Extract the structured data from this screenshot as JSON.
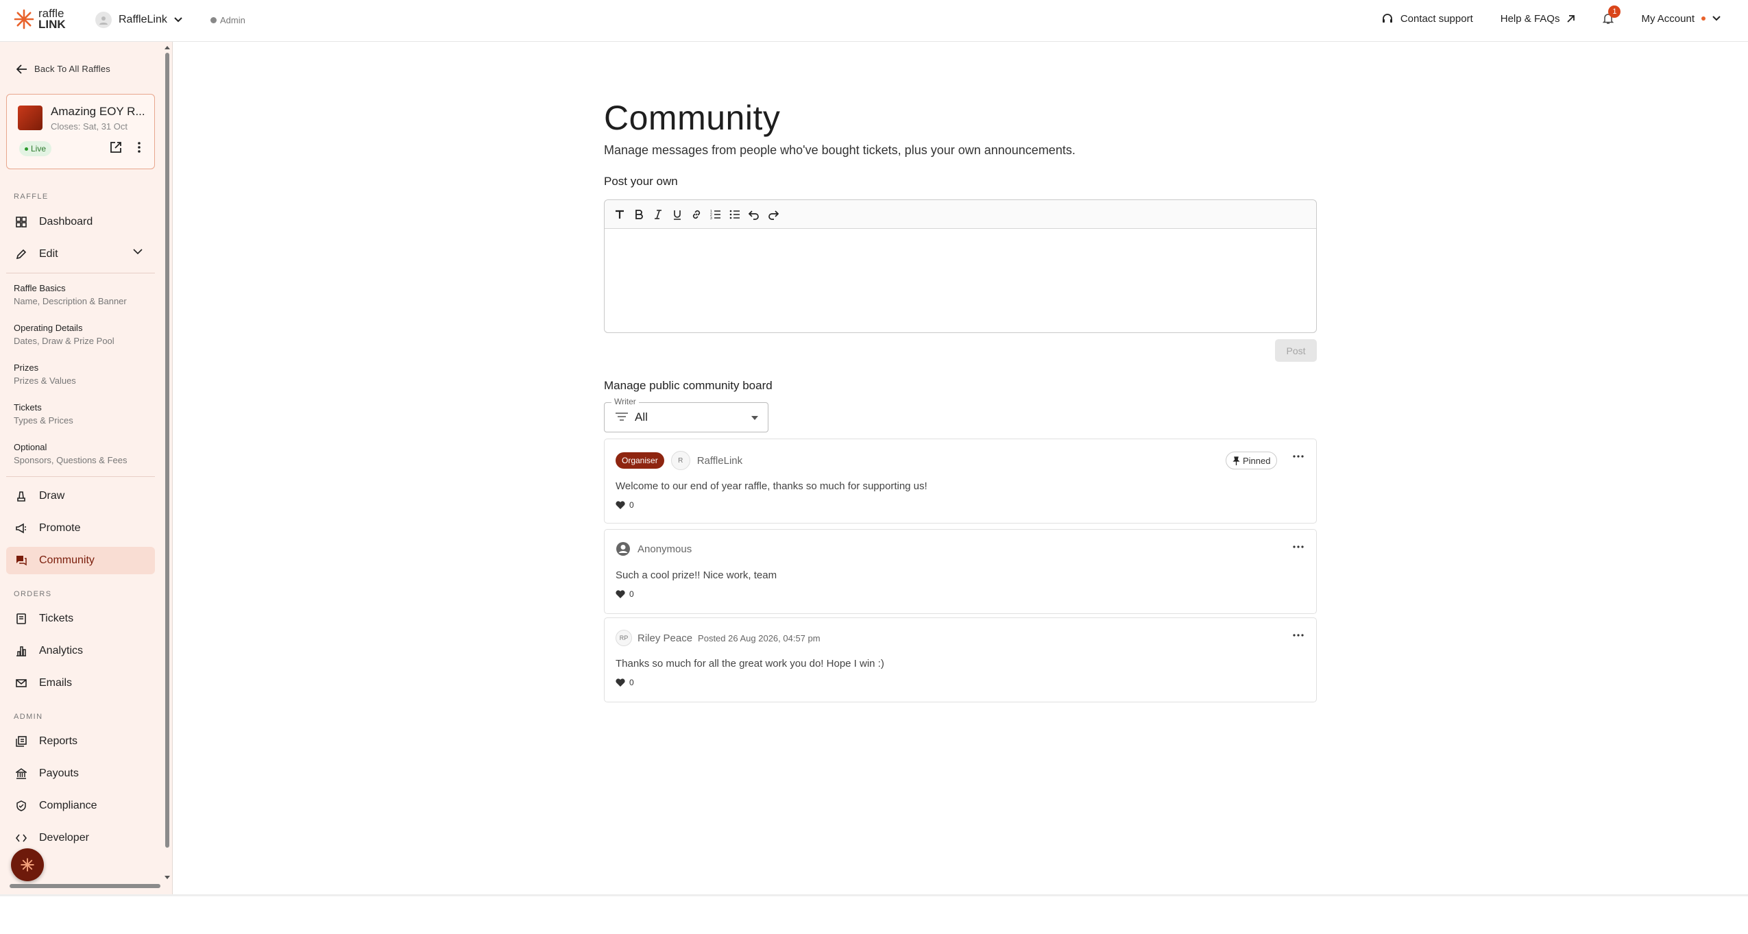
{
  "header": {
    "logo_line1": "raffle",
    "logo_line2": "LINK",
    "org_name": "RaffleLink",
    "admin_label": "Admin",
    "contact_support": "Contact support",
    "help": "Help & FAQs",
    "notification_count": "1",
    "account": "My Account"
  },
  "sidebar": {
    "back_label": "Back To All Raffles",
    "raffle": {
      "title": "Amazing EOY R...",
      "closes": "Closes: Sat, 31 Oct",
      "status": "Live"
    },
    "section_raffle": "RAFFLE",
    "dashboard": "Dashboard",
    "edit": "Edit",
    "edit_items": [
      {
        "title": "Raffle Basics",
        "desc": "Name, Description & Banner"
      },
      {
        "title": "Operating Details",
        "desc": "Dates, Draw & Prize Pool"
      },
      {
        "title": "Prizes",
        "desc": "Prizes & Values"
      },
      {
        "title": "Tickets",
        "desc": "Types & Prices"
      },
      {
        "title": "Optional",
        "desc": "Sponsors, Questions & Fees"
      }
    ],
    "draw": "Draw",
    "promote": "Promote",
    "community": "Community",
    "section_orders": "ORDERS",
    "tickets": "Tickets",
    "analytics": "Analytics",
    "emails": "Emails",
    "section_admin": "ADMIN",
    "reports": "Reports",
    "payouts": "Payouts",
    "compliance": "Compliance",
    "developer": "Developer"
  },
  "main": {
    "title": "Community",
    "description": "Manage messages from people who've bought tickets, plus your own announcements.",
    "post_heading": "Post your own",
    "post_button": "Post",
    "board_heading": "Manage public community board",
    "writer_label": "Writer",
    "writer_value": "All",
    "posts": [
      {
        "badge": "Organiser",
        "avatar": "R",
        "author": "RaffleLink",
        "posted": "",
        "pinned": "Pinned",
        "message": "Welcome to our end of year raffle, thanks so much for supporting us!",
        "likes": "0"
      },
      {
        "author": "Anonymous",
        "message": "Such a cool prize!! Nice work, team",
        "likes": "0"
      },
      {
        "avatar": "RP",
        "author": "Riley Peace",
        "posted": "Posted 26 Aug 2026, 04:57 pm",
        "message": "Thanks so much for all the great work you do! Hope I win :)",
        "likes": "0"
      }
    ]
  },
  "colors": {
    "accent": "#8e2510",
    "sidebar_bg": "#fdf1ec",
    "logo_orange": "#e8622b"
  }
}
